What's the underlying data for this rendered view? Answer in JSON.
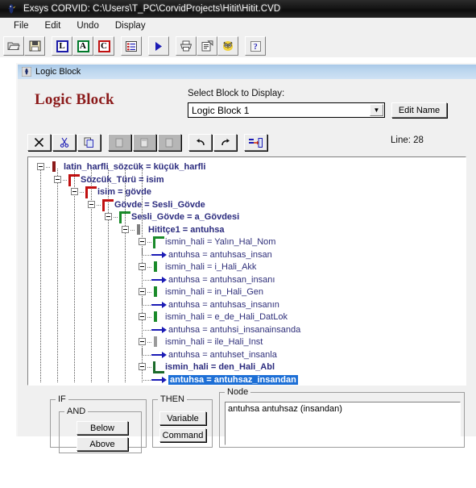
{
  "window": {
    "title": "Exsys CORVID: C:\\Users\\T_PC\\CorvidProjects\\Hitit\\Hitit.CVD",
    "icon": "corvid-bird-icon"
  },
  "menubar": {
    "items": [
      {
        "label": "File"
      },
      {
        "label": "Edit"
      },
      {
        "label": "Undo"
      },
      {
        "label": "Display"
      }
    ]
  },
  "toolbar": {
    "buttons": [
      {
        "name": "open-folder-icon",
        "glyph": "🗁"
      },
      {
        "name": "save-icon",
        "glyph": "💾"
      },
      {
        "name": "logic-block-icon",
        "glyph": "L"
      },
      {
        "name": "action-block-icon",
        "glyph": "A"
      },
      {
        "name": "command-block-icon",
        "glyph": "C"
      },
      {
        "name": "variables-list-icon",
        "glyph": "☰"
      },
      {
        "name": "run-icon",
        "glyph": "▶"
      },
      {
        "name": "print-icon",
        "glyph": "🖨"
      },
      {
        "name": "properties-icon",
        "glyph": "🗒"
      },
      {
        "name": "owl-icon",
        "glyph": "🦉"
      },
      {
        "name": "help-icon",
        "glyph": "?"
      }
    ]
  },
  "logic_block_window": {
    "title": "Logic Block",
    "heading": "Logic Block",
    "select_label": "Select Block to Display:",
    "selected_block": "Logic Block 1",
    "block_options": [
      "Logic Block 1"
    ],
    "edit_name_label": "Edit Name",
    "line_label": "Line: 28"
  },
  "edit_toolbar": {
    "buttons": [
      {
        "name": "delete-button",
        "glyph": "✕",
        "disabled": false
      },
      {
        "name": "cut-button",
        "glyph": "✂",
        "disabled": false
      },
      {
        "name": "copy-button",
        "glyph": "⧉",
        "disabled": false
      },
      {
        "name": "paste-below-button",
        "glyph": "🗎",
        "disabled": true
      },
      {
        "name": "paste-above-button",
        "glyph": "🗎",
        "disabled": true
      },
      {
        "name": "paste-into-button",
        "glyph": "🗎",
        "disabled": true
      },
      {
        "name": "undo-button",
        "glyph": "↶",
        "disabled": false
      },
      {
        "name": "redo-button",
        "glyph": "↷",
        "disabled": false
      },
      {
        "name": "indent-button",
        "glyph": "⇥",
        "disabled": false
      }
    ]
  },
  "tree": {
    "rows": [
      {
        "id": 0,
        "depth": 0,
        "text": "latin_harfli_sözcük = küçük_harfli",
        "kind": "node",
        "marker": "bar",
        "color": "#8b1a1a",
        "bold": true,
        "selected": false
      },
      {
        "id": 1,
        "depth": 1,
        "text": "Sözcük_Türü = isim",
        "kind": "node",
        "marker": "corner",
        "color": "#c01010",
        "bold": true,
        "selected": false
      },
      {
        "id": 2,
        "depth": 2,
        "text": "isim = gövde",
        "kind": "node",
        "marker": "corner",
        "color": "#c01010",
        "bold": true,
        "selected": false
      },
      {
        "id": 3,
        "depth": 3,
        "text": "Gövde = Sesli_Gövde",
        "kind": "node",
        "marker": "corner",
        "color": "#c01010",
        "bold": true,
        "selected": false
      },
      {
        "id": 4,
        "depth": 4,
        "text": "Sesli_Gövde = a_Gövdesi",
        "kind": "node",
        "marker": "corner",
        "color": "#1a8a2a",
        "bold": true,
        "selected": false
      },
      {
        "id": 5,
        "depth": 5,
        "text": "Hititçe1 = antuhsa",
        "kind": "node",
        "marker": "bar",
        "color": "#808080",
        "bold": true,
        "selected": false
      },
      {
        "id": 6,
        "depth": 6,
        "text": "ismin_hali = Yalın_Hal_Nom",
        "kind": "node",
        "marker": "corner",
        "color": "#1a8a2a",
        "bold": false,
        "selected": false
      },
      {
        "id": 7,
        "depth": 7,
        "text": "antuhsa = antuhsas_insan",
        "kind": "leaf",
        "marker": "arrow",
        "color": "#1b1bb5",
        "bold": false,
        "selected": false
      },
      {
        "id": 8,
        "depth": 6,
        "text": "ismin_hali = i_Hali_Akk",
        "kind": "node",
        "marker": "bar",
        "color": "#1a8a2a",
        "bold": false,
        "selected": false
      },
      {
        "id": 9,
        "depth": 7,
        "text": "antuhsa = antuhsan_insanı",
        "kind": "leaf",
        "marker": "arrow",
        "color": "#1b1bb5",
        "bold": false,
        "selected": false
      },
      {
        "id": 10,
        "depth": 6,
        "text": "ismin_hali = in_Hali_Gen",
        "kind": "node",
        "marker": "bar",
        "color": "#1a8a2a",
        "bold": false,
        "selected": false
      },
      {
        "id": 11,
        "depth": 7,
        "text": "antuhsa = antuhsas_insanın",
        "kind": "leaf",
        "marker": "arrow",
        "color": "#1b1bb5",
        "bold": false,
        "selected": false
      },
      {
        "id": 12,
        "depth": 6,
        "text": "ismin_hali = e_de_Hali_DatLok",
        "kind": "node",
        "marker": "bar",
        "color": "#1a8a2a",
        "bold": false,
        "selected": false
      },
      {
        "id": 13,
        "depth": 7,
        "text": "antuhsa = antuhsi_insanainsanda",
        "kind": "leaf",
        "marker": "arrow",
        "color": "#1b1bb5",
        "bold": false,
        "selected": false
      },
      {
        "id": 14,
        "depth": 6,
        "text": "ismin_hali = ile_Hali_Inst",
        "kind": "node",
        "marker": "bar",
        "color": "#9a9a9a",
        "bold": false,
        "selected": false
      },
      {
        "id": 15,
        "depth": 7,
        "text": "antuhsa = antuhset_insanla",
        "kind": "leaf",
        "marker": "arrow",
        "color": "#1b1bb5",
        "bold": false,
        "selected": false
      },
      {
        "id": 16,
        "depth": 6,
        "text": "ismin_hali = den_Hali_Abl",
        "kind": "node",
        "marker": "lcorner",
        "color": "#1a6a2a",
        "bold": true,
        "selected": false
      },
      {
        "id": 17,
        "depth": 7,
        "text": "antuhsa = antuhsaz_insandan",
        "kind": "leaf",
        "marker": "arrow",
        "color": "#1b1bb5",
        "bold": true,
        "selected": true
      }
    ]
  },
  "bottom": {
    "if_group": {
      "title": "IF"
    },
    "and_group": {
      "title": "AND",
      "buttons": [
        {
          "label": "Below"
        },
        {
          "label": "Above"
        }
      ]
    },
    "then_group": {
      "title": "THEN",
      "buttons": [
        {
          "label": "Variable"
        },
        {
          "label": "Command"
        }
      ]
    },
    "node_group": {
      "title": "Node",
      "text": "antuhsa antuhsaz (insandan)"
    }
  },
  "colors": {
    "title_bar": "#151515",
    "child_title": "#bcd6ee",
    "heading": "#8b1a1a",
    "selection": "#1d6fd6",
    "tree_text": "#2f2f7a",
    "face": "#f0f0f0"
  }
}
